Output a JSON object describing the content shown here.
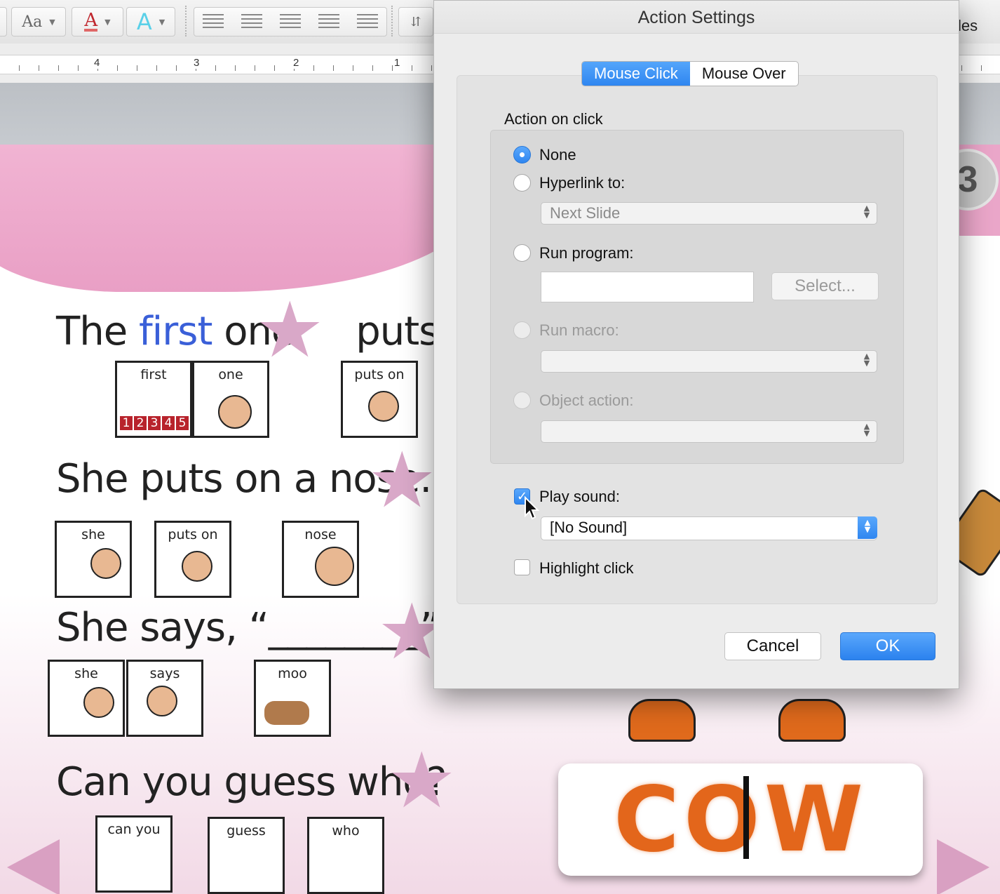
{
  "toolbar": {
    "font_style_icon": "Aa",
    "font_color_icon": "A",
    "text_effects_icon": "A",
    "partial_label": "les"
  },
  "ruler": {
    "numbers": [
      "4",
      "3",
      "2",
      "1"
    ]
  },
  "slide": {
    "page_number": "3",
    "line1": {
      "w1": "The",
      "w2": "first",
      "w3": "one",
      "w4": "puts on"
    },
    "line2": "She puts on a nose.",
    "line3": "She says, “________”.",
    "line4": "Can you guess who?",
    "cards": {
      "first": "first",
      "one": "one",
      "puts_on": "puts on",
      "she": "she",
      "puts_on_2": "puts on",
      "nose": "nose",
      "she_2": "she",
      "says": "says",
      "moo": "moo",
      "can_you": "can you",
      "guess": "guess",
      "who": "who"
    },
    "counting_numbers": [
      "1",
      "2",
      "3",
      "4",
      "5"
    ],
    "word_tile": "COW",
    "colors": {
      "pink": "#e99fc5",
      "accent_blue": "#3a5fd8",
      "cow_orange": "#e3661b"
    }
  },
  "dialog": {
    "title": "Action Settings",
    "tabs": [
      {
        "label": "Mouse Click",
        "active": true
      },
      {
        "label": "Mouse Over",
        "active": false
      }
    ],
    "section_label": "Action on click",
    "options": {
      "none": {
        "label": "None",
        "selected": true
      },
      "hyperlink": {
        "label": "Hyperlink to:",
        "selected": false,
        "value": "Next Slide"
      },
      "run_program": {
        "label": "Run program:",
        "selected": false,
        "value": "",
        "button": "Select..."
      },
      "run_macro": {
        "label": "Run macro:",
        "disabled": true,
        "value": ""
      },
      "object_action": {
        "label": "Object action:",
        "disabled": true,
        "value": ""
      }
    },
    "play_sound": {
      "label": "Play sound:",
      "checked": true,
      "value": "[No Sound]"
    },
    "highlight_click": {
      "label": "Highlight click",
      "checked": false
    },
    "cancel_label": "Cancel",
    "ok_label": "OK",
    "colors": {
      "accent": "#2f86f0"
    }
  }
}
